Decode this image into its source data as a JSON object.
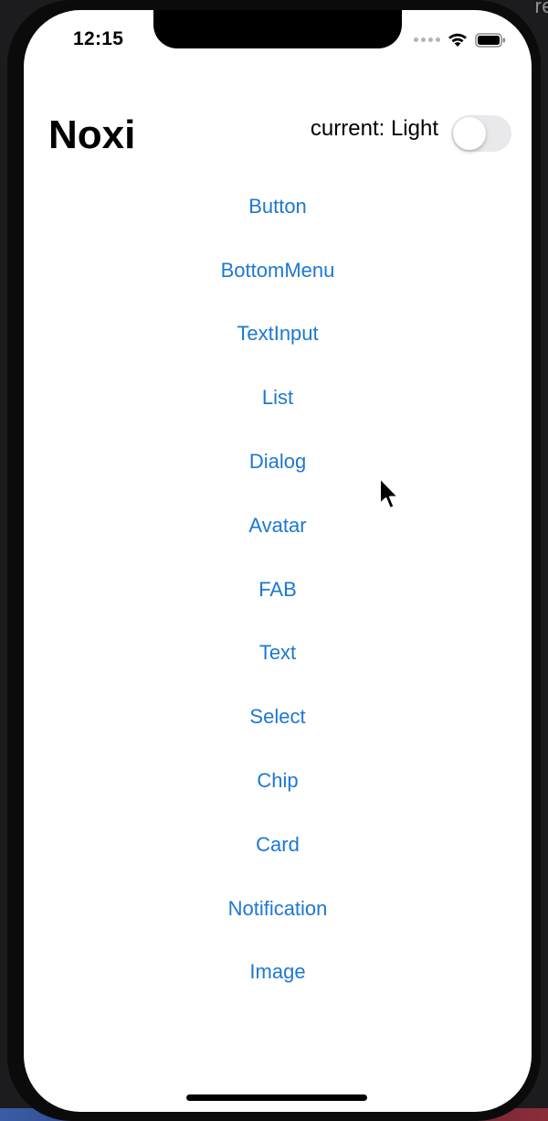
{
  "backdrop": {
    "corner_text": "re"
  },
  "status_bar": {
    "time": "12:15"
  },
  "header": {
    "title": "Noxi",
    "mode_label": "current: Light",
    "toggle_on": false
  },
  "menu": {
    "items": [
      {
        "label": "Button"
      },
      {
        "label": "BottomMenu"
      },
      {
        "label": "TextInput"
      },
      {
        "label": "List"
      },
      {
        "label": "Dialog"
      },
      {
        "label": "Avatar"
      },
      {
        "label": "FAB"
      },
      {
        "label": "Text"
      },
      {
        "label": "Select"
      },
      {
        "label": "Chip"
      },
      {
        "label": "Card"
      },
      {
        "label": "Notification"
      },
      {
        "label": "Image"
      }
    ]
  },
  "colors": {
    "link": "#1d78d2",
    "toggle_off": "#e9e9eb",
    "screen_bg": "#ffffff"
  }
}
